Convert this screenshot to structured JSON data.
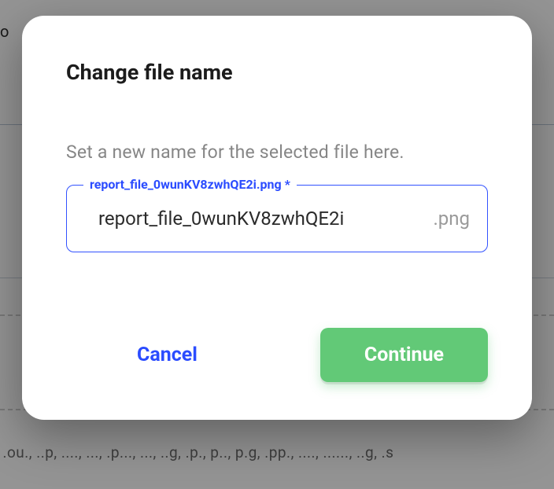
{
  "background": {
    "top_fragment": "vo",
    "bottom_fragment": ", .ou., ..p, ...., ..., .p..., ..., ..g, .p., p.., p.g, .pp., ...., ......, ..g, .s"
  },
  "modal": {
    "title": "Change file name",
    "instruction": "Set a new name for the selected file here.",
    "field": {
      "label": "report_file_0wunKV8zwhQE2i.png *",
      "value": "report_file_0wunKV8zwhQE2i",
      "extension": ".png"
    },
    "actions": {
      "cancel": "Cancel",
      "continue": "Continue"
    }
  }
}
